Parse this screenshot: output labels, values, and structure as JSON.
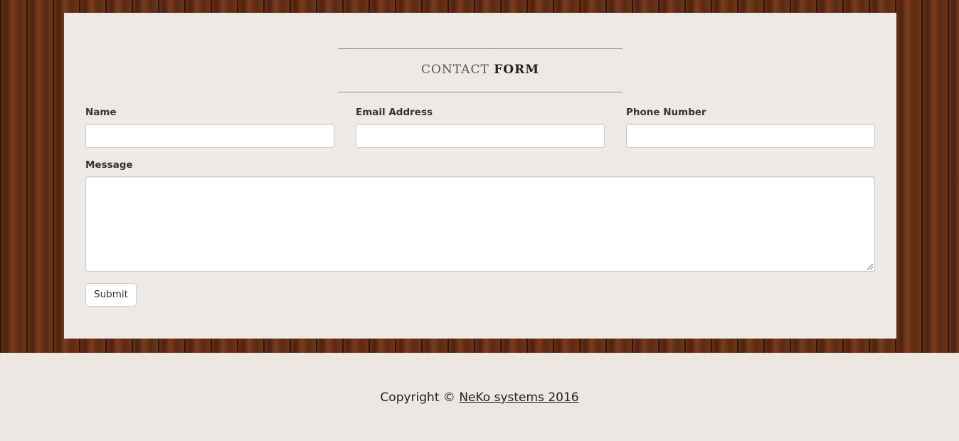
{
  "form": {
    "title_light": "CONTACT",
    "title_strong": "FORM",
    "fields": {
      "name": {
        "label": "Name",
        "value": "",
        "placeholder": ""
      },
      "email": {
        "label": "Email Address",
        "value": "",
        "placeholder": ""
      },
      "phone": {
        "label": "Phone Number",
        "value": "",
        "placeholder": ""
      },
      "message": {
        "label": "Message",
        "value": "",
        "placeholder": ""
      }
    },
    "submit_label": "Submit"
  },
  "footer": {
    "copyright_prefix": "Copyright ©",
    "link_text": "NeKo systems 2016"
  },
  "colors": {
    "wood": "#5a2a14",
    "panel": "#efe9e6",
    "footer_bg": "#ebe7e5",
    "text": "#333333"
  }
}
